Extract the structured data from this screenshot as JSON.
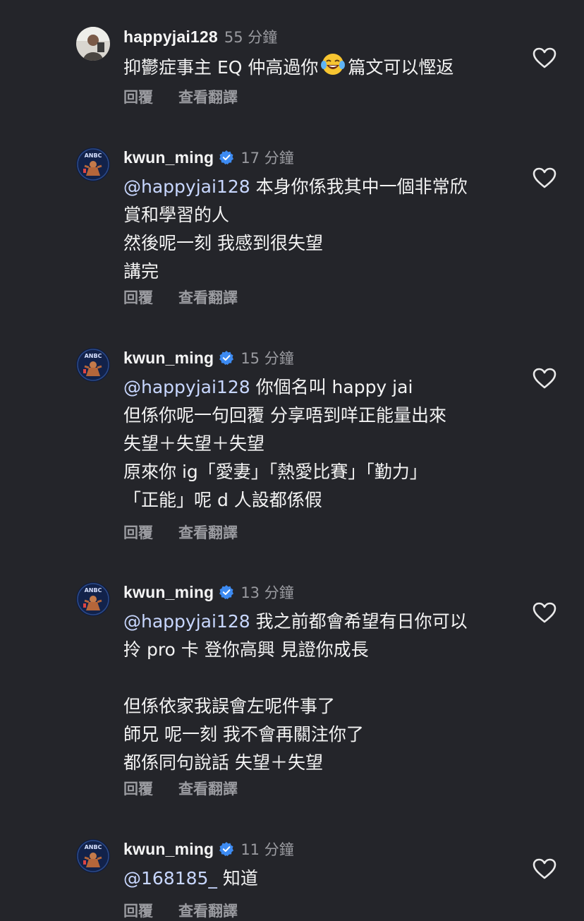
{
  "colors": {
    "background": "#24252a",
    "text": "#f3f3f3",
    "muted": "#9a9ba0",
    "mention": "#c8d7ff",
    "verified": "#3d8bf2"
  },
  "comments": [
    {
      "username": "happyjai128",
      "verified": false,
      "time": "55 分鐘",
      "text_before_emoji": "抑鬱症事主 EQ 仲高過你",
      "emoji": "face-with-tears-of-joy",
      "text_after_emoji": "篇文可以慳返",
      "reply": "回覆",
      "translate": "查看翻譯"
    },
    {
      "username": "kwun_ming",
      "verified": true,
      "time": "17 分鐘",
      "mention": "@happyjai128",
      "lines": [
        " 本身你係我其中一個非常欣",
        "賞和學習的人",
        "然後呢一刻 我感到很失望",
        "講完"
      ],
      "reply": "回覆",
      "translate": "查看翻譯"
    },
    {
      "username": "kwun_ming",
      "verified": true,
      "time": "15 分鐘",
      "mention": "@happyjai128",
      "lines": [
        " 你個名叫 happy jai",
        "但係你呢一句回覆 分享唔到咩正能量出來",
        "失望＋失望＋失望",
        "原來你 ig「愛妻」「熱愛比賽」「勤力」",
        "「正能」呢 d 人設都係假"
      ],
      "reply": "回覆",
      "translate": "查看翻譯"
    },
    {
      "username": "kwun_ming",
      "verified": true,
      "time": "13 分鐘",
      "mention": "@happyjai128",
      "lines": [
        " 我之前都會希望有日你可以",
        "拎 pro 卡 登你高興 見證你成長",
        "",
        "但係依家我誤會左呢件事了",
        "師兄 呢一刻 我不會再關注你了",
        "都係同句說話 失望＋失望"
      ],
      "reply": "回覆",
      "translate": "查看翻譯"
    },
    {
      "username": "kwun_ming",
      "verified": true,
      "time": "11 分鐘",
      "mention": "@168185_",
      "lines": [
        " 知道"
      ],
      "reply": "回覆",
      "translate": "查看翻譯"
    }
  ]
}
